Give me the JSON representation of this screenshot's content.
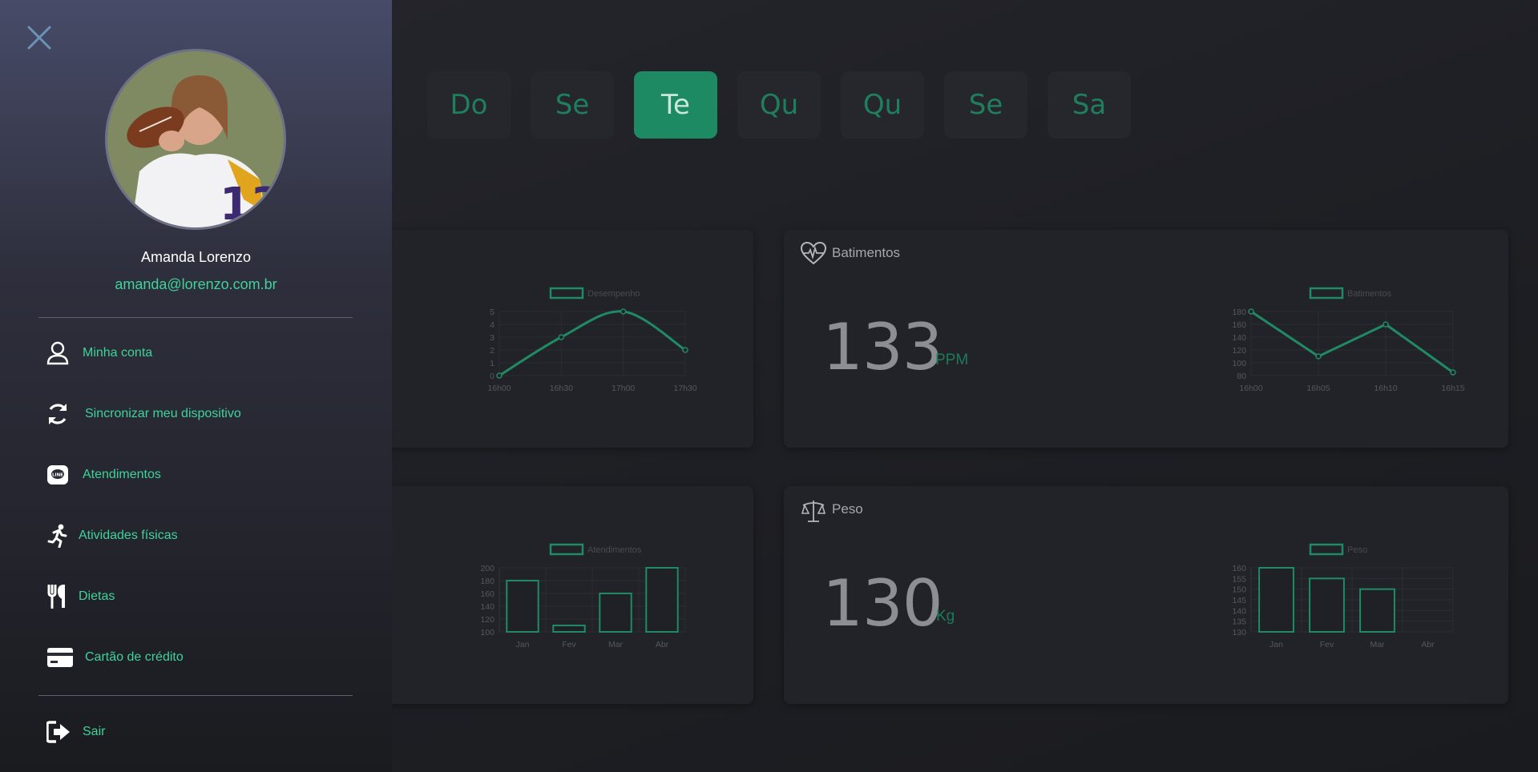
{
  "days": [
    {
      "label": "Do",
      "active": false
    },
    {
      "label": "Se",
      "active": false
    },
    {
      "label": "Te",
      "active": true
    },
    {
      "label": "Qu",
      "active": false
    },
    {
      "label": "Qu",
      "active": false
    },
    {
      "label": "Se",
      "active": false
    },
    {
      "label": "Sa",
      "active": false
    }
  ],
  "user": {
    "name": "Amanda Lorenzo",
    "email": "amanda@lorenzo.com.br"
  },
  "menu": [
    {
      "label": "Minha conta",
      "icon": "user-icon"
    },
    {
      "label": "Sincronizar meu dispositivo",
      "icon": "sync-icon"
    },
    {
      "label": "Atendimentos",
      "icon": "chat-icon"
    },
    {
      "label": "Atividades físicas",
      "icon": "running-icon"
    },
    {
      "label": "Dietas",
      "icon": "utensils-icon"
    },
    {
      "label": "Cartão de crédito",
      "icon": "credit-card-icon"
    }
  ],
  "logout": {
    "label": "Sair",
    "icon": "sign-out-icon"
  },
  "cards": {
    "batimentos": {
      "title": "Batimentos",
      "value": "133",
      "unit": "PPM",
      "icon": "heartbeat-icon"
    },
    "peso": {
      "title": "Peso",
      "value": "130",
      "unit": "Kg",
      "icon": "scale-icon"
    }
  },
  "colors": {
    "accent": "#1e8a64",
    "text_accent": "#3fd39b",
    "chart_line": "#1f8a63"
  },
  "chart_data": [
    {
      "type": "line",
      "title": "",
      "legend": "Desempenho",
      "x": [
        "16h00",
        "16h30",
        "17h00",
        "17h30"
      ],
      "series": [
        {
          "name": "Desempenho",
          "values": [
            0,
            3,
            5,
            2
          ]
        }
      ],
      "ylim": [
        0,
        5
      ],
      "yticks": [
        0,
        1,
        2,
        3,
        4,
        5
      ],
      "smooth": true
    },
    {
      "type": "line",
      "title": "",
      "legend": "Batimentos",
      "x": [
        "16h00",
        "16h05",
        "16h10",
        "16h15"
      ],
      "series": [
        {
          "name": "Batimentos",
          "values": [
            180,
            110,
            160,
            85
          ]
        }
      ],
      "ylim": [
        80,
        180
      ],
      "yticks": [
        80,
        100,
        120,
        140,
        160,
        180
      ],
      "smooth": false
    },
    {
      "type": "bar",
      "title": "",
      "legend": "Atendimentos",
      "categories": [
        "Jan",
        "Fev",
        "Mar",
        "Abr"
      ],
      "series": [
        {
          "name": "Atendimentos",
          "values": [
            180,
            110,
            160,
            200
          ]
        }
      ],
      "ylim": [
        100,
        200
      ],
      "yticks": [
        100,
        120,
        140,
        160,
        180,
        200
      ]
    },
    {
      "type": "bar",
      "title": "",
      "legend": "Peso",
      "categories": [
        "Jan",
        "Fev",
        "Mar",
        "Abr"
      ],
      "series": [
        {
          "name": "Peso",
          "values": [
            160,
            155,
            150,
            null
          ]
        }
      ],
      "ylim": [
        130,
        160
      ],
      "yticks": [
        130,
        135,
        140,
        145,
        150,
        155,
        160
      ]
    }
  ]
}
